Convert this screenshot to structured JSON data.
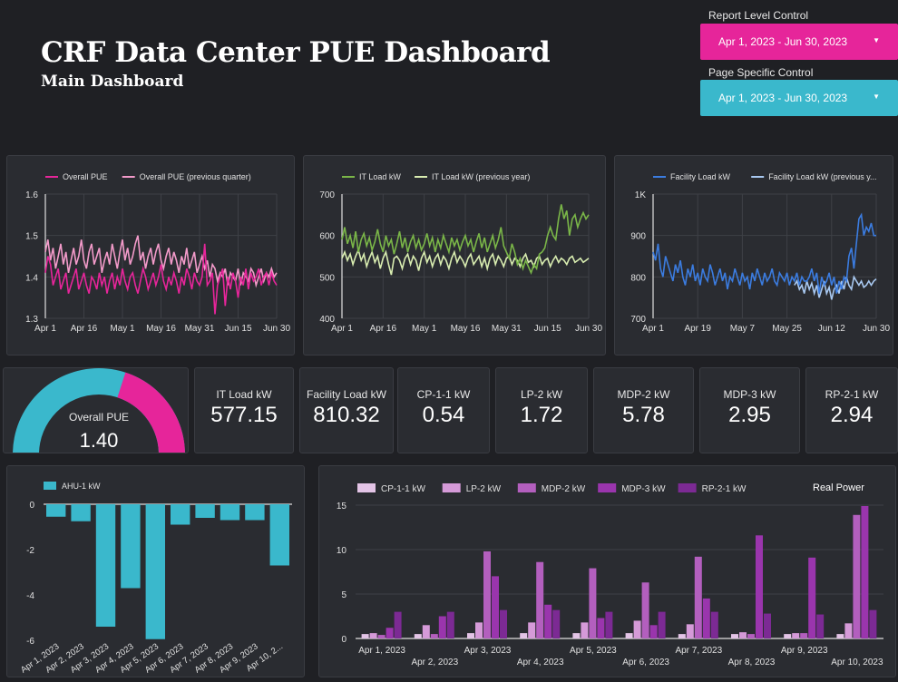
{
  "header": {
    "title": "CRF Data Center PUE Dashboard",
    "subtitle": "Main Dashboard"
  },
  "controls": {
    "report": {
      "label": "Report Level Control",
      "value": "Apr 1, 2023 - Jun 30, 2023",
      "color": "#e6259a"
    },
    "page": {
      "label": "Page Specific Control",
      "value": "Apr 1, 2023 - Jun 30, 2023",
      "color": "#3ab8cc"
    }
  },
  "icons": {
    "caret": "caret-down-icon"
  },
  "kpis": [
    {
      "label": "IT Load kW",
      "value": "577.15"
    },
    {
      "label": "Facility Load kW",
      "value": "810.32"
    },
    {
      "label": "CP-1-1 kW",
      "value": "0.54"
    },
    {
      "label": "LP-2 kW",
      "value": "1.72"
    },
    {
      "label": "MDP-2 kW",
      "value": "5.78"
    },
    {
      "label": "MDP-3 kW",
      "value": "2.95"
    },
    {
      "label": "RP-2-1 kW",
      "value": "2.94"
    }
  ],
  "gauge": {
    "label": "Overall PUE",
    "value": "1.40",
    "fraction": 0.6,
    "min": 1,
    "max": 2
  },
  "chart_data": [
    {
      "type": "line",
      "series_names": [
        "Overall PUE",
        "Overall PUE (previous quarter)"
      ],
      "colors": [
        "#e6259a",
        "#f29ac9"
      ],
      "xticks": [
        "Apr 1",
        "Apr 16",
        "May 1",
        "May 16",
        "May 31",
        "Jun 15",
        "Jun 30"
      ],
      "yticks": [
        "1.3",
        "1.4",
        "1.5",
        "1.6"
      ],
      "ylim": [
        1.3,
        1.6
      ],
      "series": [
        [
          1.41,
          1.45,
          1.43,
          1.38,
          1.4,
          1.42,
          1.37,
          1.39,
          1.41,
          1.36,
          1.38,
          1.4,
          1.42,
          1.37,
          1.39,
          1.41,
          1.38,
          1.36,
          1.4,
          1.39,
          1.37,
          1.41,
          1.38,
          1.4,
          1.36,
          1.39,
          1.41,
          1.37,
          1.4,
          1.38,
          1.42,
          1.39,
          1.37,
          1.4,
          1.41,
          1.38,
          1.36,
          1.39,
          1.42,
          1.4,
          1.37,
          1.39,
          1.41,
          1.38,
          1.4,
          1.43,
          1.39,
          1.37,
          1.4,
          1.38,
          1.41,
          1.39,
          1.36,
          1.4,
          1.38,
          1.42,
          1.4,
          1.37,
          1.41,
          1.39,
          1.38,
          1.4,
          1.48,
          1.38,
          1.39,
          1.41,
          1.31,
          1.38,
          1.4,
          1.42,
          1.33,
          1.4,
          1.37,
          1.41,
          1.39,
          1.35,
          1.4,
          1.38,
          1.42,
          1.37,
          1.41,
          1.39,
          1.4,
          1.42,
          1.38,
          1.4,
          1.41,
          1.38,
          1.41,
          1.39,
          1.38
        ],
        [
          1.46,
          1.49,
          1.44,
          1.47,
          1.42,
          1.45,
          1.48,
          1.43,
          1.46,
          1.41,
          1.44,
          1.47,
          1.43,
          1.45,
          1.49,
          1.44,
          1.42,
          1.46,
          1.48,
          1.43,
          1.45,
          1.47,
          1.41,
          1.44,
          1.46,
          1.43,
          1.48,
          1.45,
          1.42,
          1.46,
          1.49,
          1.44,
          1.47,
          1.43,
          1.45,
          1.48,
          1.5,
          1.44,
          1.46,
          1.42,
          1.45,
          1.47,
          1.43,
          1.46,
          1.48,
          1.44,
          1.42,
          1.45,
          1.47,
          1.43,
          1.46,
          1.44,
          1.41,
          1.45,
          1.43,
          1.47,
          1.42,
          1.44,
          1.46,
          1.41,
          1.43,
          1.45,
          1.42,
          1.44,
          1.4,
          1.43,
          1.42,
          1.39,
          1.41,
          1.4,
          1.42,
          1.38,
          1.41,
          1.4,
          1.39,
          1.42,
          1.38,
          1.41,
          1.4,
          1.39,
          1.42,
          1.41,
          1.38,
          1.4,
          1.42,
          1.39,
          1.41,
          1.4,
          1.42,
          1.4,
          1.41
        ]
      ]
    },
    {
      "type": "line",
      "series_names": [
        "IT Load kW",
        "IT Load kW (previous year)"
      ],
      "colors": [
        "#7ab648",
        "#d8ecb0"
      ],
      "xticks": [
        "Apr 1",
        "Apr 16",
        "May 1",
        "May 16",
        "May 31",
        "Jun 15",
        "Jun 30"
      ],
      "yticks": [
        "400",
        "500",
        "600",
        "700"
      ],
      "ylim": [
        400,
        700
      ],
      "series": [
        [
          590,
          620,
          580,
          600,
          570,
          610,
          560,
          590,
          605,
          575,
          595,
          565,
          585,
          615,
          580,
          560,
          600,
          575,
          590,
          555,
          580,
          610,
          570,
          595,
          560,
          585,
          600,
          570,
          590,
          565,
          580,
          605,
          575,
          595,
          560,
          590,
          570,
          600,
          580,
          560,
          595,
          575,
          590,
          565,
          585,
          600,
          575,
          590,
          560,
          585,
          605,
          570,
          595,
          560,
          580,
          600,
          570,
          590,
          620,
          575,
          560,
          545,
          580,
          560,
          530,
          545,
          520,
          540,
          525,
          510,
          530,
          520,
          555,
          560,
          570,
          600,
          620,
          600,
          590,
          640,
          675,
          640,
          660,
          600,
          640,
          650,
          620,
          640,
          655,
          640,
          650
        ],
        [
          545,
          560,
          540,
          555,
          530,
          550,
          565,
          540,
          555,
          525,
          545,
          560,
          535,
          550,
          520,
          545,
          560,
          530,
          505,
          545,
          550,
          540,
          520,
          545,
          555,
          530,
          550,
          540,
          515,
          545,
          560,
          535,
          550,
          525,
          545,
          555,
          530,
          550,
          540,
          520,
          545,
          560,
          535,
          550,
          540,
          525,
          545,
          555,
          530,
          540,
          550,
          525,
          545,
          520,
          545,
          555,
          530,
          550,
          540,
          525,
          545,
          550,
          530,
          545,
          540,
          525,
          545,
          555,
          535,
          540,
          525,
          545,
          550,
          530,
          540,
          545,
          525,
          540,
          550,
          535,
          545,
          540,
          530,
          545,
          550,
          535,
          540,
          545,
          535,
          540,
          545
        ]
      ]
    },
    {
      "type": "line",
      "series_names": [
        "Facility Load kW",
        "Facility Load kW (previous y..."
      ],
      "colors": [
        "#3b7ce0",
        "#a8c8f0"
      ],
      "xticks": [
        "Apr 1",
        "Apr 19",
        "May 7",
        "May 25",
        "Jun 12",
        "Jun 30"
      ],
      "yticks": [
        "700",
        "800",
        "900",
        "1K"
      ],
      "ylim": [
        700,
        1000
      ],
      "series": [
        [
          860,
          840,
          880,
          820,
          800,
          850,
          830,
          810,
          790,
          830,
          810,
          840,
          800,
          780,
          820,
          800,
          830,
          790,
          810,
          780,
          820,
          800,
          790,
          830,
          810,
          780,
          800,
          820,
          790,
          810,
          770,
          800,
          790,
          820,
          800,
          780,
          810,
          790,
          800,
          770,
          810,
          790,
          820,
          800,
          780,
          810,
          790,
          800,
          820,
          790,
          780,
          810,
          800,
          790,
          810,
          780,
          800,
          790,
          810,
          780,
          800,
          790,
          790,
          800,
          820,
          790,
          810,
          760,
          800,
          780,
          790,
          810,
          780,
          800,
          760,
          790,
          770,
          800,
          790,
          850,
          870,
          820,
          880,
          940,
          950,
          900,
          920,
          910,
          930,
          900,
          900
        ],
        [
          null,
          null,
          null,
          null,
          null,
          null,
          null,
          null,
          null,
          null,
          null,
          null,
          null,
          null,
          null,
          null,
          null,
          null,
          null,
          null,
          null,
          null,
          null,
          null,
          null,
          null,
          null,
          null,
          null,
          null,
          null,
          null,
          null,
          null,
          null,
          null,
          null,
          null,
          null,
          null,
          null,
          null,
          null,
          null,
          null,
          null,
          null,
          null,
          null,
          null,
          null,
          null,
          null,
          null,
          null,
          null,
          null,
          780,
          790,
          770,
          780,
          760,
          790,
          770,
          785,
          760,
          780,
          750,
          770,
          790,
          760,
          775,
          745,
          770,
          780,
          760,
          790,
          770,
          800,
          780,
          770,
          800,
          790,
          780,
          790,
          775,
          780,
          790,
          780,
          790,
          795
        ]
      ]
    },
    {
      "type": "bar",
      "series_names": [
        "AHU-1 kW"
      ],
      "colors": [
        "#3ab8cc"
      ],
      "categories": [
        "Apr 1, 2023",
        "Apr 2, 2023",
        "Apr 3, 2023",
        "Apr 4, 2023",
        "Apr 5, 2023",
        "Apr 6, 2023",
        "Apr 7, 2023",
        "Apr 8, 2023",
        "Apr 9, 2023",
        "Apr 10, 2..."
      ],
      "values": [
        -0.55,
        -0.75,
        -5.4,
        -3.7,
        -5.95,
        -0.9,
        -0.6,
        -0.7,
        -0.7,
        -2.7
      ],
      "yticks": [
        "0",
        "-2",
        "-4",
        "-6"
      ],
      "ylim": [
        -6,
        0
      ]
    },
    {
      "type": "bar",
      "title": "Real Power",
      "series_names": [
        "CP-1-1 kW",
        "LP-2 kW",
        "MDP-2 kW",
        "MDP-3 kW",
        "RP-2-1 kW"
      ],
      "colors": [
        "#e3c4e6",
        "#d59ad8",
        "#b35fbe",
        "#9a35ad",
        "#7c2a94"
      ],
      "categories": [
        "Apr 1, 2023",
        "Apr 2, 2023",
        "Apr 3, 2023",
        "Apr 4, 2023",
        "Apr 5, 2023",
        "Apr 6, 2023",
        "Apr 7, 2023",
        "Apr 8, 2023",
        "Apr 9, 2023",
        "Apr 10, 2023"
      ],
      "series": [
        [
          0.5,
          0.5,
          0.6,
          0.6,
          0.6,
          0.6,
          0.5,
          0.5,
          0.5,
          0.5
        ],
        [
          0.6,
          1.5,
          1.8,
          1.8,
          1.8,
          2.0,
          1.6,
          0.7,
          0.6,
          1.7
        ],
        [
          0.4,
          0.5,
          9.8,
          8.6,
          7.9,
          6.3,
          9.2,
          0.5,
          0.6,
          13.9
        ],
        [
          1.2,
          2.5,
          7.0,
          3.8,
          2.3,
          1.5,
          4.5,
          11.6,
          9.1,
          14.9
        ],
        [
          3.0,
          3.0,
          3.2,
          3.2,
          3.0,
          3.0,
          3.0,
          2.8,
          2.7,
          3.2
        ]
      ],
      "yticks": [
        "0",
        "5",
        "10",
        "15"
      ],
      "ylim": [
        0,
        15
      ]
    }
  ]
}
